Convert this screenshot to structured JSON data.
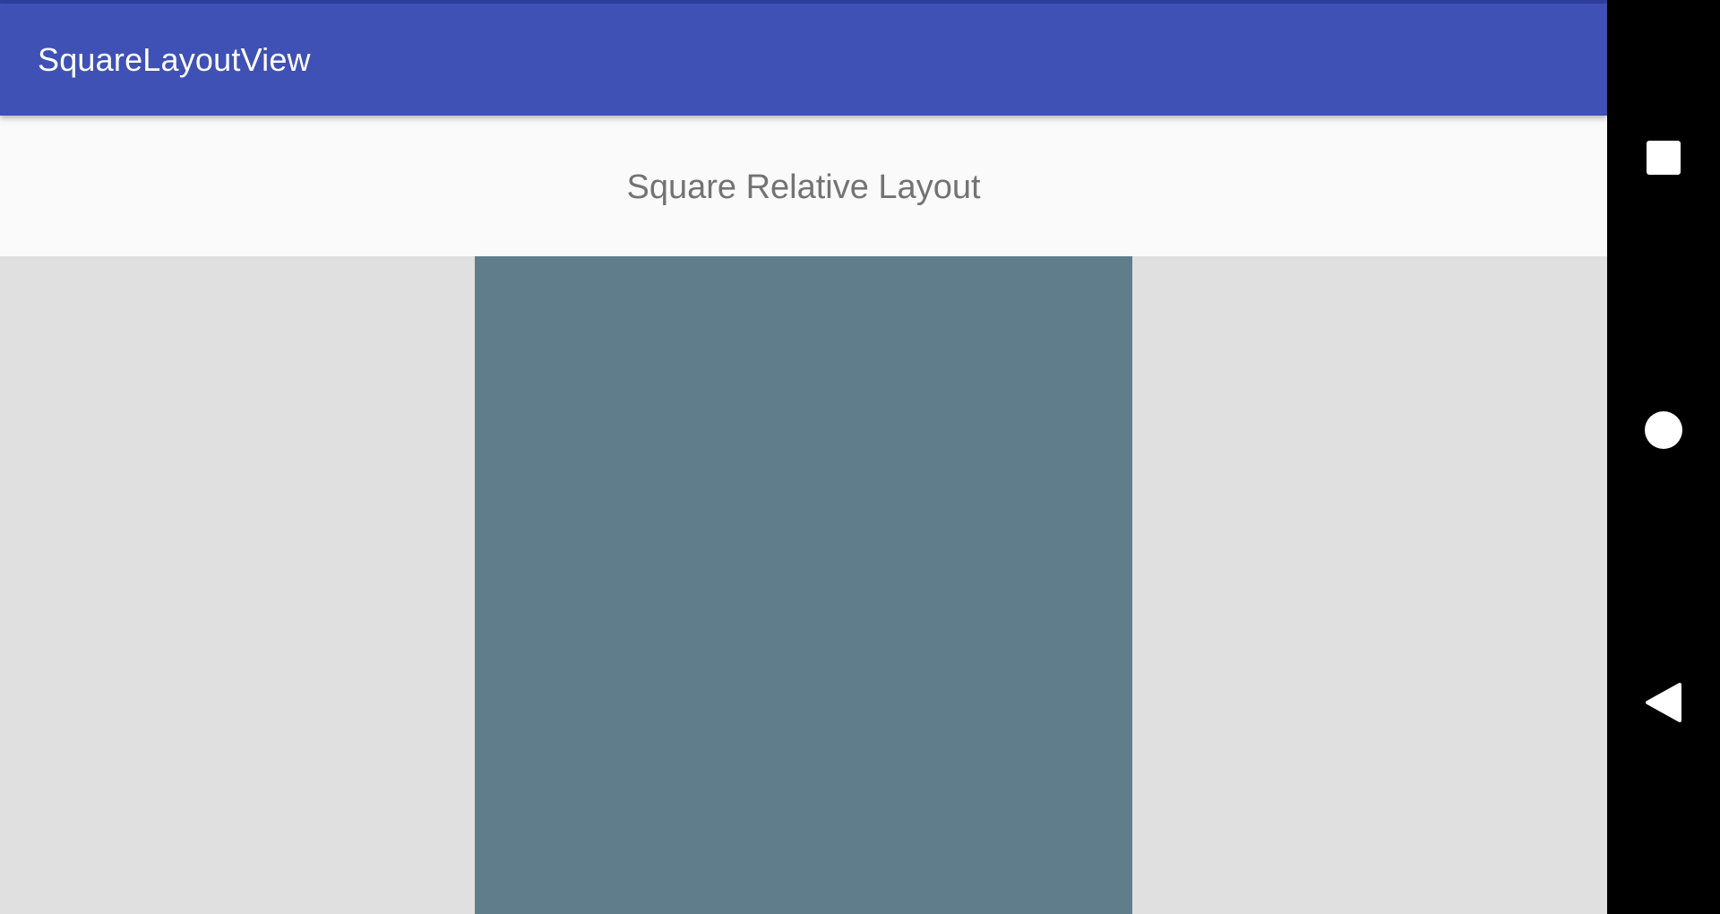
{
  "app_bar": {
    "title": "SquareLayoutView",
    "background_color": "#3f51b5",
    "status_color": "#303f9f"
  },
  "header": {
    "text": "Square Relative Layout",
    "background_color": "#fafafa"
  },
  "square_layout": {
    "fill_color": "#607d8b",
    "surround_color": "#e0e0e0"
  },
  "navigation_bar": {
    "buttons": [
      {
        "name": "recents",
        "icon": "square-icon"
      },
      {
        "name": "home",
        "icon": "circle-icon"
      },
      {
        "name": "back",
        "icon": "triangle-back-icon"
      }
    ]
  }
}
